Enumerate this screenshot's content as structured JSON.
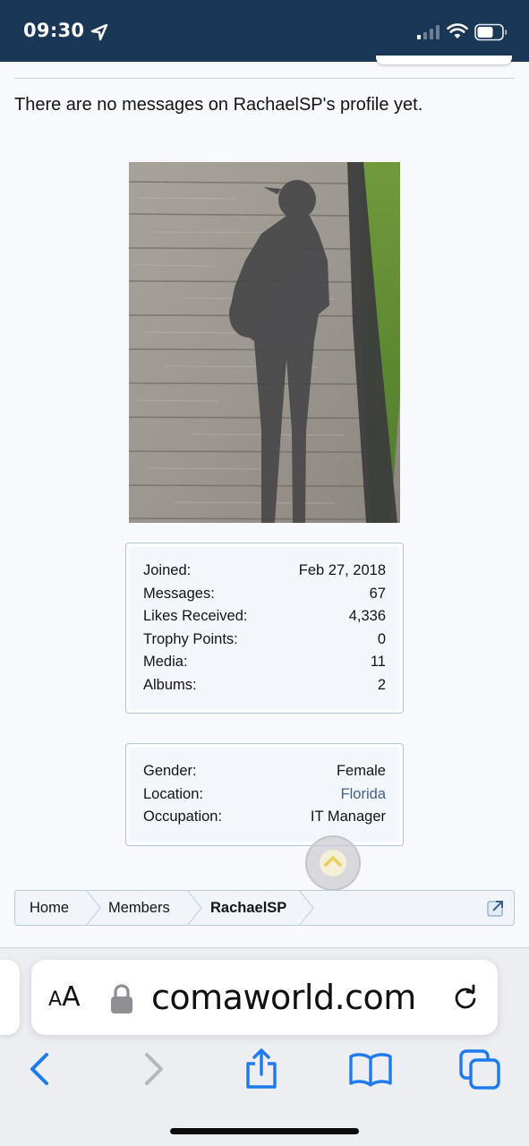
{
  "status_bar": {
    "time": "09:30",
    "icons": [
      "location-arrow-icon",
      "cellular-signal-icon",
      "wifi-icon",
      "battery-icon"
    ]
  },
  "profile": {
    "no_messages_text": "There are no messages on RachaelSP's profile yet.",
    "photo_icon": "shadow-silhouette-photo"
  },
  "stats": [
    {
      "label": "Joined:",
      "value": "Feb 27, 2018"
    },
    {
      "label": "Messages:",
      "value": "67"
    },
    {
      "label": "Likes Received:",
      "value": "4,336"
    },
    {
      "label": "Trophy Points:",
      "value": "0"
    },
    {
      "label": "Media:",
      "value": "11"
    },
    {
      "label": "Albums:",
      "value": "2"
    }
  ],
  "about": [
    {
      "label": "Gender:",
      "value": "Female"
    },
    {
      "label": "Location:",
      "value": "Florida"
    },
    {
      "label": "Occupation:",
      "value": "IT Manager"
    }
  ],
  "breadcrumb": {
    "items": [
      "Home",
      "Members",
      "RachaelSP"
    ]
  },
  "browser": {
    "aa_label_large": "A",
    "aa_label_small": "A",
    "url": "comaworld.com"
  },
  "colors": {
    "status_bar": "#1b3756",
    "link": "#47608a",
    "box_border": "#b2c5dc",
    "ios_blue": "#1f7aed"
  }
}
